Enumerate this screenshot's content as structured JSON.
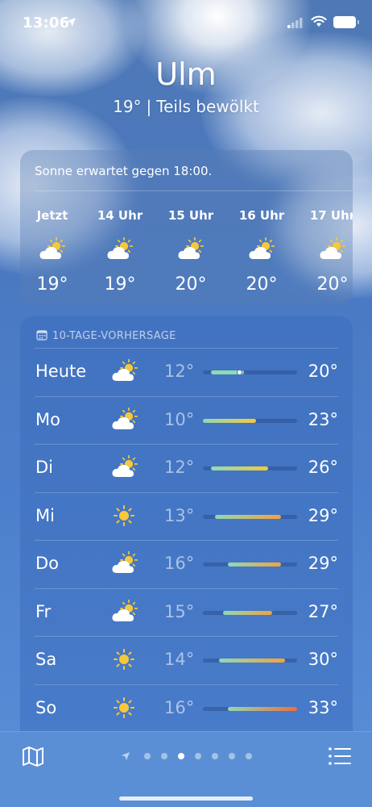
{
  "status": {
    "time": "13:06"
  },
  "header": {
    "city": "Ulm",
    "temp": "19°",
    "separator": "|",
    "condition": "Teils bewölkt"
  },
  "hourly": {
    "note": "Sonne erwartet gegen 18:00.",
    "items": [
      {
        "label": "Jetzt",
        "icon": "partly-cloudy-sun-icon",
        "temp": "19°"
      },
      {
        "label": "14 Uhr",
        "icon": "partly-cloudy-sun-icon",
        "temp": "19°"
      },
      {
        "label": "15 Uhr",
        "icon": "partly-cloudy-sun-icon",
        "temp": "20°"
      },
      {
        "label": "16 Uhr",
        "icon": "partly-cloudy-sun-icon",
        "temp": "20°"
      },
      {
        "label": "17 Uhr",
        "icon": "partly-cloudy-sun-icon",
        "temp": "20°"
      }
    ]
  },
  "daily": {
    "heading": "10-TAGE-VORHERSAGE",
    "range_min": 10,
    "range_max": 33,
    "days": [
      {
        "name": "Heute",
        "icon": "partly-cloudy-sun-icon",
        "low": "12°",
        "high": "20°",
        "low_val": 12,
        "high_val": 20,
        "current_val": 19
      },
      {
        "name": "Mo",
        "icon": "partly-cloudy-sun-icon",
        "low": "10°",
        "high": "23°",
        "low_val": 10,
        "high_val": 23
      },
      {
        "name": "Di",
        "icon": "partly-cloudy-sun-icon",
        "low": "12°",
        "high": "26°",
        "low_val": 12,
        "high_val": 26
      },
      {
        "name": "Mi",
        "icon": "sun-icon",
        "low": "13°",
        "high": "29°",
        "low_val": 13,
        "high_val": 29
      },
      {
        "name": "Do",
        "icon": "partly-cloudy-sun-icon",
        "low": "16°",
        "high": "29°",
        "low_val": 16,
        "high_val": 29
      },
      {
        "name": "Fr",
        "icon": "partly-cloudy-sun-icon",
        "low": "15°",
        "high": "27°",
        "low_val": 15,
        "high_val": 27
      },
      {
        "name": "Sa",
        "icon": "sun-icon",
        "low": "14°",
        "high": "30°",
        "low_val": 14,
        "high_val": 30
      },
      {
        "name": "So",
        "icon": "sun-icon",
        "low": "16°",
        "high": "33°",
        "low_val": 16,
        "high_val": 33
      }
    ]
  },
  "pager": {
    "page_count": 7,
    "active_index": 3
  },
  "colors": {
    "sun": "#f6c83a",
    "cool": "#8fd9b5",
    "warm": "#f3a23a",
    "hot": "#ef6f3a"
  }
}
